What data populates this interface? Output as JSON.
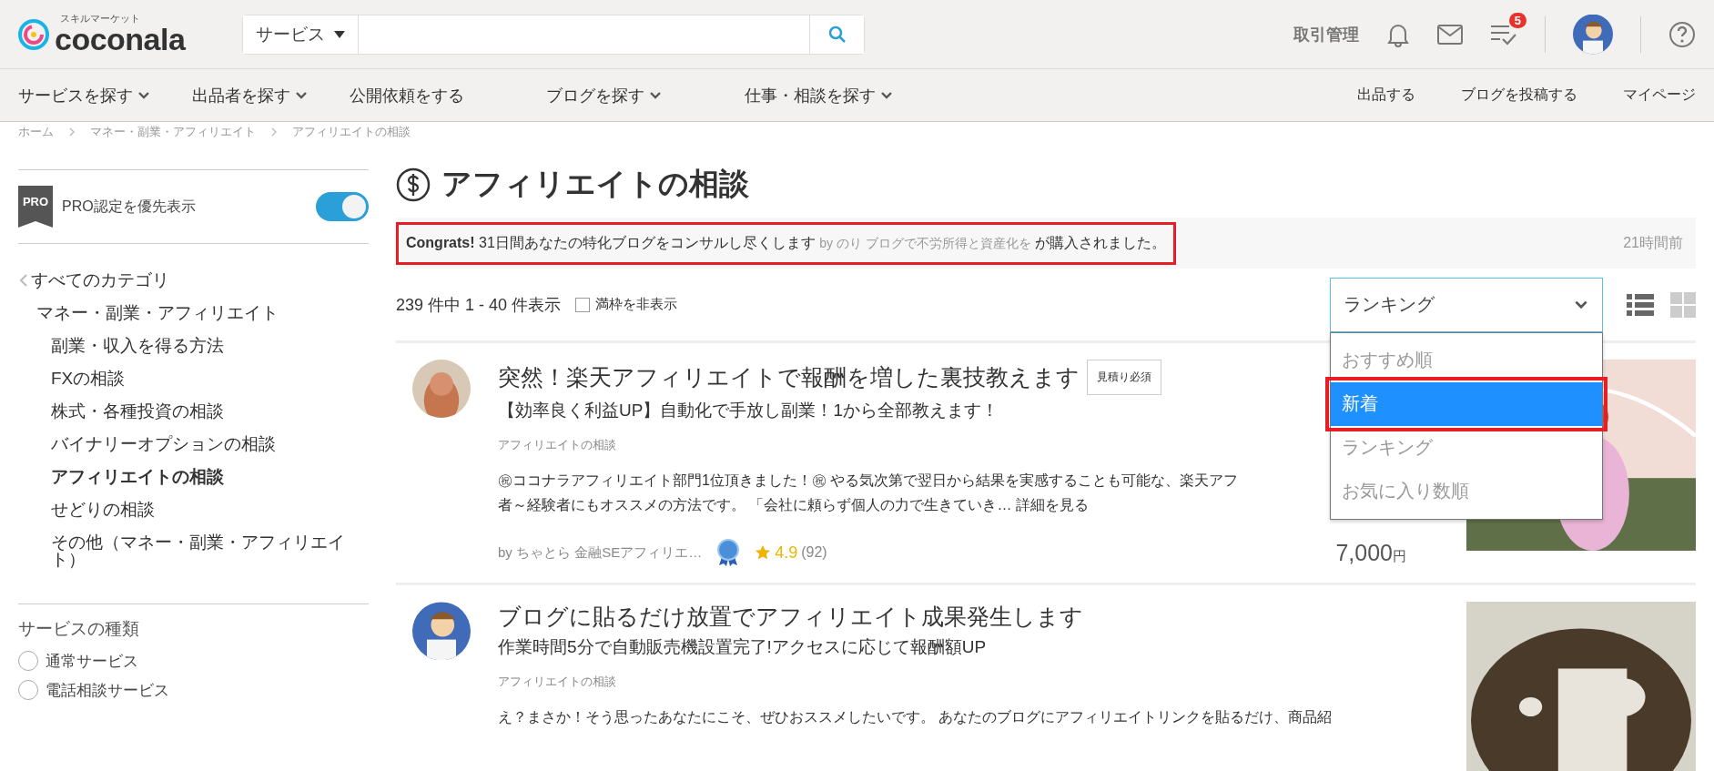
{
  "header": {
    "logo": {
      "tagline": "スキルマーケット",
      "name": "coconala"
    },
    "search": {
      "category": "サービス"
    },
    "links": [
      {
        "label": "取引管理"
      }
    ],
    "todo_badge": "5"
  },
  "nav": {
    "left": [
      {
        "label": "サービスを探す",
        "dropdown": true
      },
      {
        "label": "出品者を探す",
        "dropdown": true
      },
      {
        "label": "公開依頼をする",
        "dropdown": false
      },
      {
        "label": "ブログを探す",
        "dropdown": true
      },
      {
        "label": "仕事・相談を探す",
        "dropdown": true
      }
    ],
    "right": [
      {
        "label": "出品する"
      },
      {
        "label": "ブログを投稿する"
      },
      {
        "label": "マイページ"
      }
    ]
  },
  "breadcrumb": [
    "ホーム",
    "マネー・副業・アフィリエイト",
    "アフィリエイトの相談"
  ],
  "sidebar": {
    "pro_filter": {
      "badge": "PRO",
      "label": "PRO認定を優先表示",
      "on": true
    },
    "categories": {
      "label": "すべてのカテゴリ",
      "children": [
        {
          "label": "マネー・副業・アフィリエイト",
          "children": [
            {
              "label": "副業・収入を得る方法",
              "selected": false
            },
            {
              "label": "FXの相談",
              "selected": false
            },
            {
              "label": "株式・各種投資の相談",
              "selected": false
            },
            {
              "label": "バイナリーオプションの相談",
              "selected": false
            },
            {
              "label": "アフィリエイトの相談",
              "selected": true
            },
            {
              "label": "せどりの相談",
              "selected": false
            },
            {
              "label": "その他（マネー・副業・アフィリエイト）",
              "selected": false
            }
          ]
        }
      ]
    },
    "service_type": {
      "title": "サービスの種類",
      "options": [
        {
          "label": "通常サービス",
          "selected": false
        },
        {
          "label": "電話相談サービス",
          "selected": false
        }
      ]
    }
  },
  "main": {
    "title": "アフィリエイトの相談",
    "notice": {
      "lead": "Congrats!",
      "service": "31日間あなたの特化ブログをコンサルし尽くします",
      "by": "by のり",
      "seller_title": "ブログで不労所得と資産化を",
      "suffix": "が購入されました。",
      "time": "21時間前",
      "highlighted": true
    },
    "result_count": "239 件中 1 - 40 件表示",
    "hide_full": {
      "label": "満枠を非表示",
      "checked": false
    },
    "sort": {
      "value": "ランキング",
      "expanded": true,
      "options": [
        {
          "label": "おすすめ順",
          "hovered": false,
          "highlighted": false
        },
        {
          "label": "新着",
          "hovered": true,
          "highlighted": true
        },
        {
          "label": "ランキング",
          "hovered": false,
          "highlighted": false
        },
        {
          "label": "お気に入り数順",
          "hovered": false,
          "highlighted": false
        }
      ]
    },
    "view_modes": [
      {
        "kind": "list",
        "selected": true
      },
      {
        "kind": "grid",
        "selected": false
      }
    ],
    "listings": [
      {
        "title": "突然！楽天アフィリエイトで報酬を増した裏技教えます",
        "tag": "見積り必須",
        "subtitle": "【効率良く利益UP】自動化で手放し副業！1から全部教えます！",
        "category": "アフィリエイトの相談",
        "description": [
          "㊗ココナラアフィリエイト部門1位頂きました！㊗ やる気次第で翌日から結果を実感することも可能な、楽天アフ",
          "者～経験者にもオススメの方法です。 「会社に頼らず個人の力で生きていき…"
        ],
        "more_link": "詳細を見る",
        "seller": "by  ちゃとら 金融SEアフィリエ…",
        "rating": "4.9",
        "reviews": "(92)",
        "price": "7,000",
        "currency": "円"
      },
      {
        "title": "ブログに貼るだけ放置でアフィリエイト成果発生します",
        "subtitle": "作業時間5分で自動販売機設置完了!アクセスに応じて報酬額UP",
        "category": "アフィリエイトの相談",
        "description": [
          "え？まさか！そう思ったあなたにこそ、ぜひおススメしたいです。 あなたのブログにアフィリエイトリンクを貼るだけ、商品紹"
        ]
      }
    ]
  }
}
